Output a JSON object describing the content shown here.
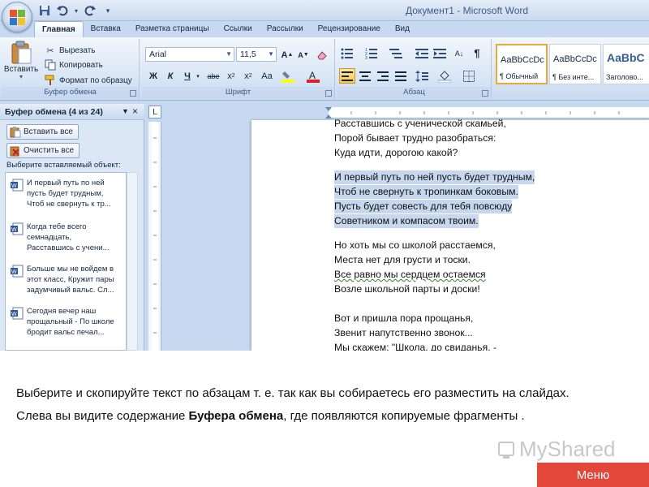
{
  "window": {
    "title": "Документ1 - Microsoft Word"
  },
  "tabs": [
    "Главная",
    "Вставка",
    "Разметка страницы",
    "Ссылки",
    "Рассылки",
    "Рецензирование",
    "Вид"
  ],
  "ribbon": {
    "clipboard": {
      "paste": "Вставить",
      "cut": "Вырезать",
      "copy": "Копировать",
      "format_painter": "Формат по образцу",
      "label": "Буфер обмена"
    },
    "font": {
      "name": "Arial",
      "size": "11,5",
      "bold": "Ж",
      "italic": "К",
      "underline": "Ч",
      "strike": "abe",
      "label": "Шрифт"
    },
    "paragraph": {
      "label": "Абзац"
    },
    "styles": {
      "tiles": [
        {
          "sample": "AaBbCcDc",
          "name": "¶ Обычный"
        },
        {
          "sample": "AaBbCcDc",
          "name": "¶ Без инте..."
        },
        {
          "sample": "AaBbC",
          "name": "Заголово..."
        }
      ]
    }
  },
  "clipboard_pane": {
    "title": "Буфер обмена (4 из 24)",
    "paste_all": "Вставить все",
    "clear_all": "Очистить все",
    "prompt": "Выберите вставляемый объект:",
    "items": [
      [
        "И первый путь по ней",
        "пусть будет трудным,",
        "Чтоб не свернуть к тр..."
      ],
      [
        "Когда тебе всего",
        "семнадцать,",
        "Расставшись с учени..."
      ],
      [
        "Больше мы не войдем в",
        "этот класс, Кружит пары",
        "задумчивый вальс. Сл..."
      ],
      [
        "Сегодня вечер наш",
        "прощальный - По школе",
        "бродит вальс печал..."
      ]
    ]
  },
  "document": {
    "lines": [
      {
        "text": "Расставшись с ученической скамьей,",
        "hl": false
      },
      {
        "text": "Порой бывает трудно разобраться:",
        "hl": false
      },
      {
        "text": "Куда идти, дорогою какой?",
        "hl": false
      },
      {
        "text": "И первый  путь по ней пусть будет трудным,",
        "hl": true
      },
      {
        "text": "Чтоб не свернуть к тропинкам  боковым.",
        "hl": true
      },
      {
        "text": "Пусть будет совесть для тебя повсюду",
        "hl": true
      },
      {
        "text": "Советником и компасом  твоим.",
        "hl": true
      },
      {
        "text": "Но хоть мы со школой расстаемся,",
        "hl": false
      },
      {
        "text": "Места нет для грусти и тоски.",
        "hl": false
      },
      {
        "text": "Все равно мы сердцем остаемся",
        "hl": false
      },
      {
        "text": "Возле школьной парты и доски!",
        "hl": false
      },
      {
        "text": "Вот и пришла пора  прощанья,",
        "hl": false
      },
      {
        "text": "Звенит напутственно  звонок...",
        "hl": false
      },
      {
        "text": "Мы скажем: \"Школа, до свиданья, -",
        "hl": false
      }
    ]
  },
  "caption": {
    "line1": "Выберите и скопируйте текст по абзацам т. е.  так как вы собираетесь его разместить на слайдах.",
    "line2_pre": "Слева вы видите содержание ",
    "line2_bold": "Буфера обмена",
    "line2_post": ", где появляются копируемые фрагменты ."
  },
  "watermark": "MyShared",
  "menu_button": "Меню"
}
